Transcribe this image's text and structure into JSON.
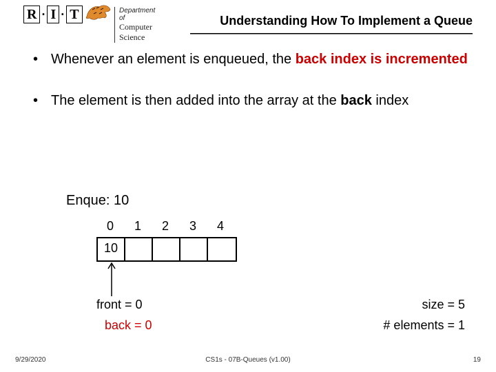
{
  "header": {
    "rit_R": "R",
    "rit_dot1": "·",
    "rit_I": "I",
    "rit_dot2": "·",
    "rit_T": "T",
    "dept_line1": "Department of",
    "dept_line2": "Computer Science",
    "title": "Understanding How To Implement a Queue"
  },
  "bullets": {
    "b1_a": "Whenever an element is enqueued, the ",
    "b1_b": "back index is incremented",
    "b2_a": "The element is then added into the array at the ",
    "b2_b": "back",
    "b2_c": " index"
  },
  "diagram": {
    "enque": "Enque: 10",
    "indices": [
      "0",
      "1",
      "2",
      "3",
      "4"
    ],
    "cells": [
      "10",
      "",
      "",
      "",
      ""
    ],
    "front": "front = 0",
    "back": "back = 0",
    "size": "size = 5",
    "elements": "# elements = 1"
  },
  "footer": {
    "left": "9/29/2020",
    "mid": "CS1s - 07B-Queues (v1.00)",
    "right": "19"
  }
}
